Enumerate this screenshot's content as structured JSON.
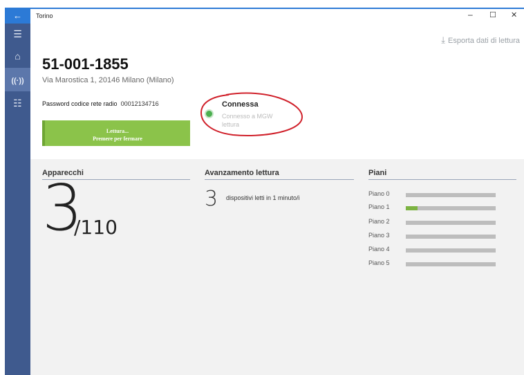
{
  "window": {
    "title": "Torino",
    "minimize": "–",
    "maximize": "☐",
    "close": "✕"
  },
  "export": {
    "label": "Esporta dati di lettura",
    "icon": "download-icon"
  },
  "header": {
    "code": "51-001-1855",
    "address": "Via Marostica 1, 20146 Milano (Milano)",
    "password_label": "Password codice rete radio",
    "password_value": "00012134716",
    "read_button_line1": "Lettura...",
    "read_button_line2": "Premere per fermare"
  },
  "connection": {
    "status": "Connessa",
    "detail": "Connesso a MGW lettura"
  },
  "apparecchi": {
    "title": "Apparecchi",
    "count": "3",
    "total": "/110"
  },
  "progress": {
    "title": "Avanzamento lettura",
    "count": "3",
    "text": "dispositivi letti in 1 minuto/i"
  },
  "piani": {
    "title": "Piani",
    "items": [
      {
        "label": "Piano 0",
        "progress": 0
      },
      {
        "label": "Piano 1",
        "progress": 0.13
      },
      {
        "label": "Piano 2",
        "progress": 0
      },
      {
        "label": "Piano 3",
        "progress": 0
      },
      {
        "label": "Piano 4",
        "progress": 0
      },
      {
        "label": "Piano 5",
        "progress": 0
      }
    ]
  },
  "colors": {
    "accent": "#2c7ad6",
    "rail": "#3f5a8e",
    "green": "#8bc34a",
    "ring": "#d0202a"
  }
}
